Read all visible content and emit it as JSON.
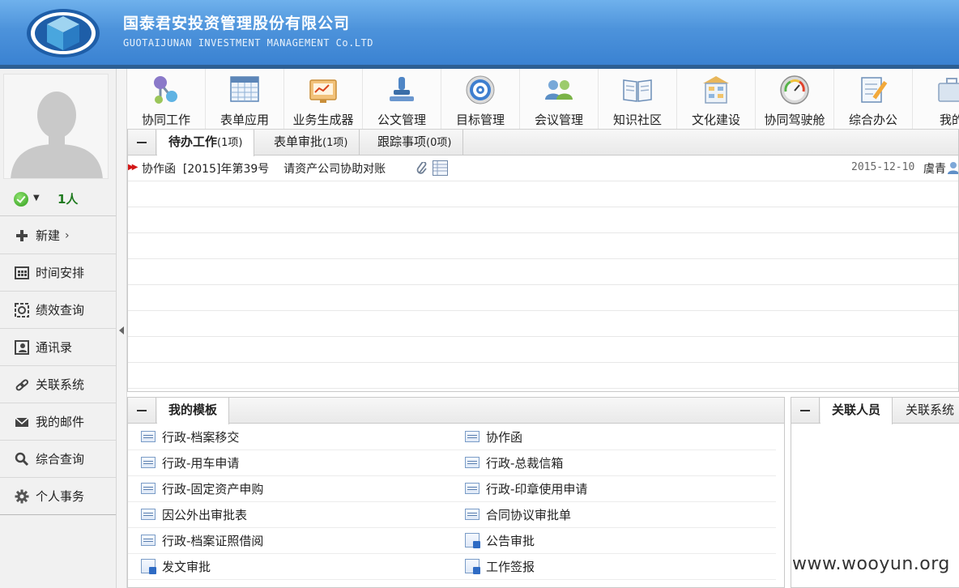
{
  "header": {
    "title_cn": "国泰君安投资管理股份有限公司",
    "title_en": "GUOTAIJUNAN INVESTMENT MANAGEMENT Co.LTD"
  },
  "status": {
    "online_count": "1人"
  },
  "sidebar": {
    "items": [
      {
        "label": "新建",
        "icon": "plus-icon"
      },
      {
        "label": "时间安排",
        "icon": "calendar-icon"
      },
      {
        "label": "绩效查询",
        "icon": "target-square-icon"
      },
      {
        "label": "通讯录",
        "icon": "contact-book-icon"
      },
      {
        "label": "关联系统",
        "icon": "link-icon"
      },
      {
        "label": "我的邮件",
        "icon": "mail-icon"
      },
      {
        "label": "综合查询",
        "icon": "search-icon"
      },
      {
        "label": "个人事务",
        "icon": "gear-icon"
      }
    ]
  },
  "toolbar": {
    "items": [
      {
        "label": "协同工作",
        "icon": "molecule-icon"
      },
      {
        "label": "表单应用",
        "icon": "spreadsheet-icon"
      },
      {
        "label": "业务生成器",
        "icon": "chart-window-icon"
      },
      {
        "label": "公文管理",
        "icon": "stamp-icon"
      },
      {
        "label": "目标管理",
        "icon": "bullseye-icon"
      },
      {
        "label": "会议管理",
        "icon": "people-icon"
      },
      {
        "label": "知识社区",
        "icon": "book-icon"
      },
      {
        "label": "文化建设",
        "icon": "building-icon"
      },
      {
        "label": "协同驾驶舱",
        "icon": "gauge-icon"
      },
      {
        "label": "综合办公",
        "icon": "notepad-icon"
      },
      {
        "label": "我的",
        "icon": "briefcase-icon"
      }
    ]
  },
  "todo_panel": {
    "tabs": [
      {
        "label": "待办工作",
        "count": "(1项)"
      },
      {
        "label": "表单审批",
        "count": "(1项)"
      },
      {
        "label": "跟踪事项",
        "count": "(0项)"
      }
    ],
    "rows": [
      {
        "type": "协作函",
        "doc_no": "[2015]年第39号",
        "subject": "请资产公司协助对账",
        "date": "2015-12-10",
        "user": "虞青"
      }
    ]
  },
  "template_panel": {
    "tab": "我的模板",
    "items": [
      {
        "label": "行政-档案移交",
        "icon": "form-icon"
      },
      {
        "label": "协作函",
        "icon": "form-icon"
      },
      {
        "label": "行政-用车申请",
        "icon": "form-icon"
      },
      {
        "label": "行政-总裁信箱",
        "icon": "form-icon"
      },
      {
        "label": "行政-固定资产申购",
        "icon": "form-icon"
      },
      {
        "label": "行政-印章使用申请",
        "icon": "form-icon"
      },
      {
        "label": "因公外出审批表",
        "icon": "form-icon"
      },
      {
        "label": "合同协议审批单",
        "icon": "form-icon"
      },
      {
        "label": "行政-档案证照借阅",
        "icon": "form-icon"
      },
      {
        "label": "公告审批",
        "icon": "starred-doc-icon"
      },
      {
        "label": "发文审批",
        "icon": "starred-doc-icon"
      },
      {
        "label": "工作签报",
        "icon": "starred-doc-icon"
      }
    ]
  },
  "related_panel": {
    "tabs": [
      {
        "label": "关联人员"
      },
      {
        "label": "关联系统"
      }
    ]
  },
  "watermark": "www.wooyun.org"
}
